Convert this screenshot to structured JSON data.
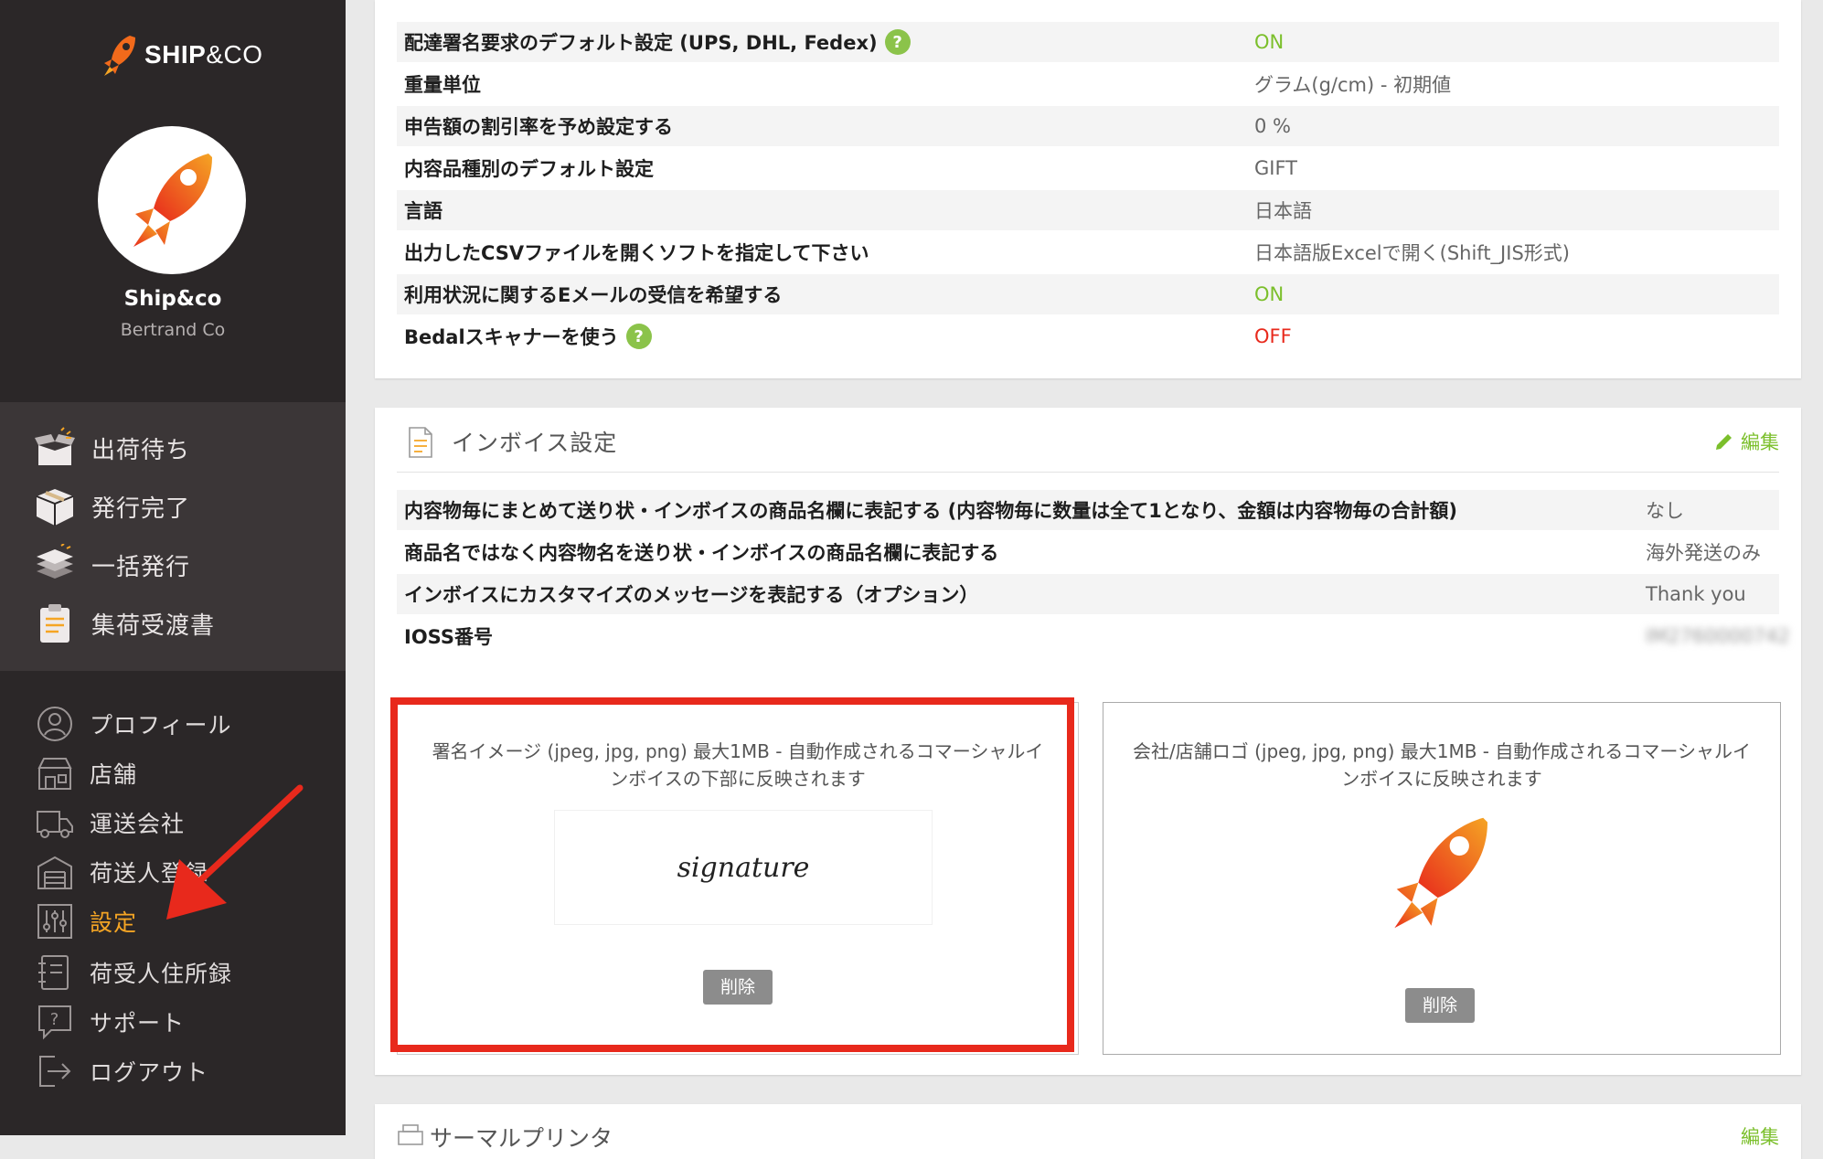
{
  "brand": {
    "logo_text_a": "SHIP",
    "logo_text_b": "&CO"
  },
  "user": {
    "name": "Ship&co",
    "company": "Bertrand Co"
  },
  "nav_primary": [
    {
      "label": "出荷待ち",
      "icon": "open-box-icon"
    },
    {
      "label": "発行完了",
      "icon": "closed-box-icon"
    },
    {
      "label": "一括発行",
      "icon": "stack-icon"
    },
    {
      "label": "集荷受渡書",
      "icon": "clipboard-icon"
    }
  ],
  "nav_secondary": [
    {
      "label": "プロフィール",
      "icon": "user-icon"
    },
    {
      "label": "店舗",
      "icon": "store-icon"
    },
    {
      "label": "運送会社",
      "icon": "truck-icon"
    },
    {
      "label": "荷送人登録",
      "icon": "warehouse-icon"
    },
    {
      "label": "設定",
      "icon": "sliders-icon",
      "active": true
    },
    {
      "label": "荷受人住所録",
      "icon": "address-book-icon"
    },
    {
      "label": "サポート",
      "icon": "help-bubble-icon"
    },
    {
      "label": "ログアウト",
      "icon": "logout-icon"
    }
  ],
  "settings_rows": [
    {
      "label": "配達署名要求のデフォルト設定 (UPS, DHL, Fedex)",
      "value": "ON",
      "help": "?"
    },
    {
      "label": "重量単位",
      "value": "グラム(g/cm) - 初期値"
    },
    {
      "label": "申告額の割引率を予め設定する",
      "value": "0 %"
    },
    {
      "label": "内容品種別のデフォルト設定",
      "value": "GIFT"
    },
    {
      "label": "言語",
      "value": "日本語"
    },
    {
      "label": "出力したCSVファイルを開くソフトを指定して下さい",
      "value": "日本語版Excelで開く(Shift_JIS形式)"
    },
    {
      "label": "利用状況に関するEメールの受信を希望する",
      "value": "ON"
    },
    {
      "label": "Bedalスキャナーを使う",
      "value": "OFF",
      "help": "?"
    }
  ],
  "invoice": {
    "title": "インボイス設定",
    "edit_label": "編集",
    "rows": [
      {
        "label": "内容物毎にまとめて送り状・インボイスの商品名欄に表記する (内容物毎に数量は全て1となり、金額は内容物毎の合計額)",
        "value": "なし"
      },
      {
        "label": "商品名ではなく内容物名を送り状・インボイスの商品名欄に表記する",
        "value": "海外発送のみ"
      },
      {
        "label": "インボイスにカスタマイズのメッセージを表記する（オプション）",
        "value": "Thank you"
      },
      {
        "label": "IOSS番号",
        "value": "IM2760000742"
      }
    ],
    "signature_box": {
      "description": "署名イメージ (jpeg, jpg, png) 最大1MB - 自動作成されるコマーシャルインボイスの下部に反映されます",
      "image_text": "signature",
      "delete_label": "削除"
    },
    "logo_box": {
      "description": "会社/店舗ロゴ (jpeg, jpg, png) 最大1MB - 自動作成されるコマーシャルインボイスに反映されます",
      "delete_label": "削除"
    }
  },
  "thermal": {
    "title": "サーマルプリンタ",
    "edit_label": "編集"
  },
  "colors": {
    "accent_green": "#7bbf2b",
    "off_red": "#e8291c",
    "active_orange": "#f5a524",
    "sidebar_bg": "#2b2728"
  }
}
